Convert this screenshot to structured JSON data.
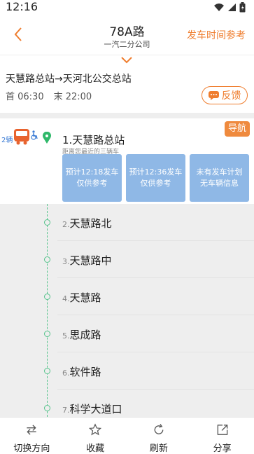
{
  "status": {
    "time": "12:16"
  },
  "nav": {
    "title": "78A路",
    "subtitle": "一汽二分公司",
    "timetable_label": "发车时间参考"
  },
  "route": {
    "direction": "天慧路总站→天河北公交总站",
    "first_bus": "首 06:30",
    "last_bus": "末 22:00",
    "feedback_label": "反馈"
  },
  "current": {
    "bus_count": "2辆",
    "nav_label": "导航",
    "stop_name": "1.天慧路总站",
    "hint": "距离您最近的三辆车",
    "etas": [
      {
        "line1": "预计12:18发车",
        "line2": "仅供参考"
      },
      {
        "line1": "预计12:36发车",
        "line2": "仅供参考"
      },
      {
        "line1": "未有发车计划",
        "line2": "无车辆信息"
      }
    ]
  },
  "stops": [
    {
      "index": "2.",
      "name": "天慧路北"
    },
    {
      "index": "3.",
      "name": "天慧路中"
    },
    {
      "index": "4.",
      "name": "天慧路"
    },
    {
      "index": "5.",
      "name": "思成路"
    },
    {
      "index": "6.",
      "name": "软件路"
    },
    {
      "index": "7.",
      "name": "科学大道口"
    }
  ],
  "tabs": [
    {
      "label": "切换方向",
      "icon": "switch-direction-icon"
    },
    {
      "label": "收藏",
      "icon": "star-icon"
    },
    {
      "label": "刷新",
      "icon": "refresh-icon"
    },
    {
      "label": "分享",
      "icon": "share-icon"
    }
  ],
  "colors": {
    "accent": "#ef7d2e",
    "line": "#55c38b",
    "eta_card": "#8fb8e6",
    "bus": "#e8632e"
  }
}
